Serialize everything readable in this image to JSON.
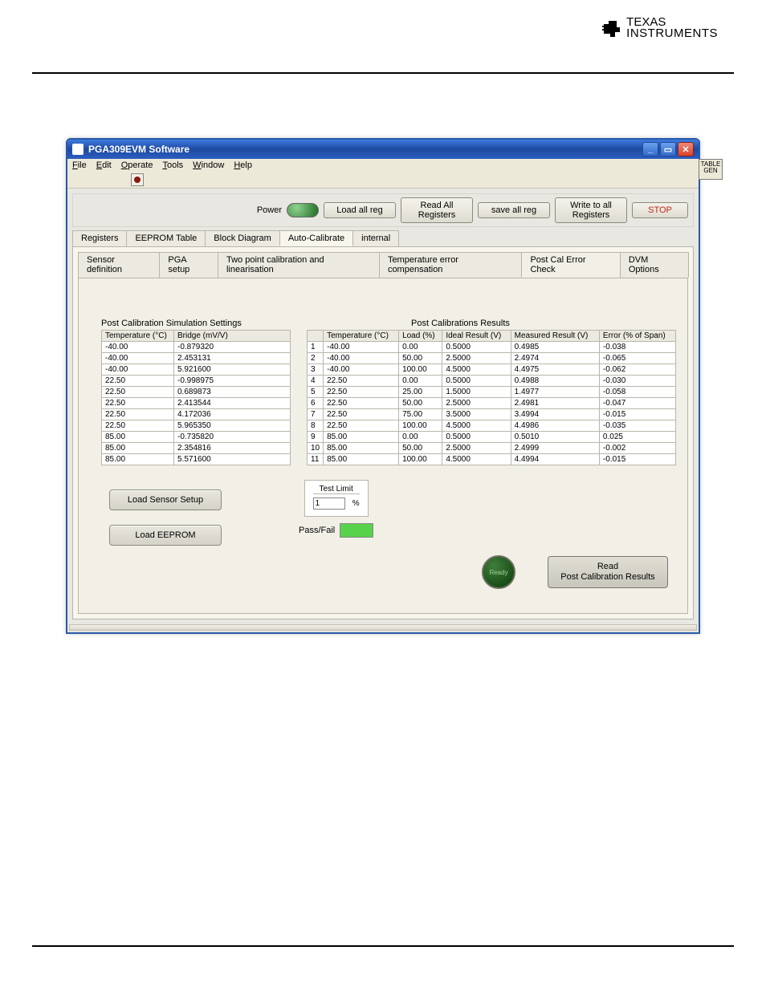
{
  "brand": {
    "line1": "TEXAS",
    "line2": "INSTRUMENTS"
  },
  "window": {
    "title": "PGA309EVM Software"
  },
  "menu": [
    "File",
    "Edit",
    "Operate",
    "Tools",
    "Window",
    "Help"
  ],
  "side_tab": "TABLE\nGEN",
  "toolbar": {
    "power": "Power",
    "load_all_reg": "Load all reg",
    "read_all_reg": "Read All Registers",
    "save_all_reg": "save all reg",
    "write_all_reg": "Write to all Registers",
    "stop": "STOP"
  },
  "main_tabs": [
    "Registers",
    "EEPROM Table",
    "Block Diagram",
    "Auto-Calibrate",
    "internal"
  ],
  "main_active": 3,
  "sub_tabs": [
    "Sensor definition",
    "PGA setup",
    "Two point calibration and linearisation",
    "Temperature error compensation",
    "Post Cal Error Check",
    "DVM Options"
  ],
  "sub_active": 4,
  "left": {
    "title": "Post Calibration Simulation Settings",
    "headers": [
      "Temperature (°C)",
      "Bridge (mV/V)"
    ],
    "rows": [
      [
        "-40.00",
        "-0.879320"
      ],
      [
        "-40.00",
        "2.453131"
      ],
      [
        "-40.00",
        "5.921600"
      ],
      [
        "22.50",
        "-0.998975"
      ],
      [
        "22.50",
        "0.689873"
      ],
      [
        "22.50",
        "2.413544"
      ],
      [
        "22.50",
        "4.172036"
      ],
      [
        "22.50",
        "5.965350"
      ],
      [
        "85.00",
        "-0.735820"
      ],
      [
        "85.00",
        "2.354816"
      ],
      [
        "85.00",
        "5.571600"
      ]
    ]
  },
  "right": {
    "title": "Post Calibrations Results",
    "headers": [
      "",
      "Temperature (°C)",
      "Load (%)",
      "Ideal Result (V)",
      "Measured Result (V)",
      "Error (% of Span)"
    ],
    "rows": [
      [
        "1",
        "-40.00",
        "0.00",
        "0.5000",
        "0.4985",
        "-0.038"
      ],
      [
        "2",
        "-40.00",
        "50.00",
        "2.5000",
        "2.4974",
        "-0.065"
      ],
      [
        "3",
        "-40.00",
        "100.00",
        "4.5000",
        "4.4975",
        "-0.062"
      ],
      [
        "4",
        "22.50",
        "0.00",
        "0.5000",
        "0.4988",
        "-0.030"
      ],
      [
        "5",
        "22.50",
        "25.00",
        "1.5000",
        "1.4977",
        "-0.058"
      ],
      [
        "6",
        "22.50",
        "50.00",
        "2.5000",
        "2.4981",
        "-0.047"
      ],
      [
        "7",
        "22.50",
        "75.00",
        "3.5000",
        "3.4994",
        "-0.015"
      ],
      [
        "8",
        "22.50",
        "100.00",
        "4.5000",
        "4.4986",
        "-0.035"
      ],
      [
        "9",
        "85.00",
        "0.00",
        "0.5000",
        "0.5010",
        "0.025"
      ],
      [
        "10",
        "85.00",
        "50.00",
        "2.5000",
        "2.4999",
        "-0.002"
      ],
      [
        "11",
        "85.00",
        "100.00",
        "4.5000",
        "4.4994",
        "-0.015"
      ]
    ]
  },
  "buttons": {
    "load_sensor": "Load Sensor Setup",
    "load_eeprom": "Load EEPROM",
    "read_post": "Read\nPost Calibration Results"
  },
  "test_limit": {
    "label": "Test Limit",
    "value": "1",
    "unit": "%",
    "passfail_label": "Pass/Fail"
  },
  "ready": "Ready"
}
